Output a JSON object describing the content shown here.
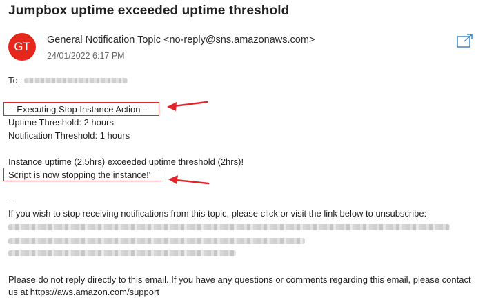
{
  "email": {
    "subject": "Jumpbox uptime exceeded uptime threshold",
    "avatar_initials": "GT",
    "avatar_color": "#e6271c",
    "sender": "General Notification Topic <no-reply@sns.amazonaws.com>",
    "date": "24/01/2022 6:17 PM",
    "popout_icon": "open-in-new-window-icon",
    "to_label": "To:"
  },
  "body": {
    "line1": "-- Executing Stop Instance Action --",
    "line2": "Uptime Threshold: 2 hours",
    "line3": "Notification Threshold: 1 hours",
    "line4": "Instance uptime (2.5hrs) exceeded uptime threshold (2hrs)!",
    "line5": "Script is now stopping the instance!'",
    "separator": "--",
    "unsubscribe_text": "If you wish to stop receiving notifications from this topic, please click or visit the link below to unsubscribe:",
    "footer_line1": "Please do not reply directly to this email. If you have any questions or comments regarding this email, please contact",
    "footer_us_at": "us at ",
    "support_link": "https://aws.amazon.com/support"
  },
  "annotations": {
    "highlight_color": "#e0262a"
  }
}
